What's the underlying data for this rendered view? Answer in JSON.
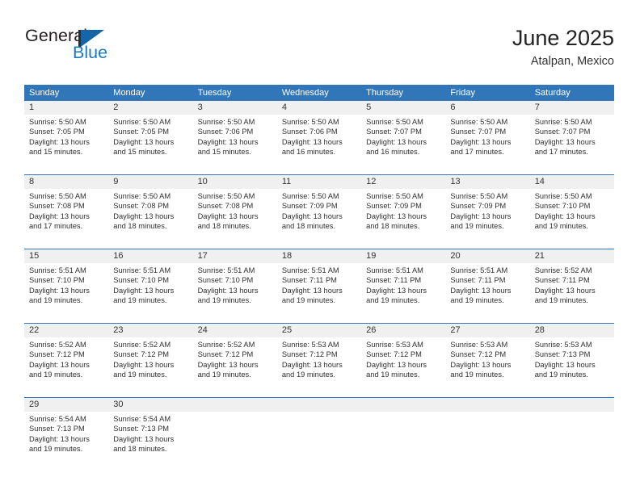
{
  "brand": {
    "name_part1": "General",
    "name_part2": "Blue",
    "logo_icon": "sailboat-logo-icon",
    "color_dark": "#231f20",
    "color_blue": "#1c7ac0"
  },
  "header": {
    "title": "June 2025",
    "location": "Atalpan, Mexico"
  },
  "theme": {
    "header_blue": "#3176b8",
    "daynum_band": "#f0f0f0",
    "text": "#303030"
  },
  "calendar": {
    "weekday_headers": [
      "Sunday",
      "Monday",
      "Tuesday",
      "Wednesday",
      "Thursday",
      "Friday",
      "Saturday"
    ],
    "weeks": [
      [
        {
          "day": "1",
          "sunrise": "Sunrise: 5:50 AM",
          "sunset": "Sunset: 7:05 PM",
          "daylight_1": "Daylight: 13 hours",
          "daylight_2": "and 15 minutes."
        },
        {
          "day": "2",
          "sunrise": "Sunrise: 5:50 AM",
          "sunset": "Sunset: 7:05 PM",
          "daylight_1": "Daylight: 13 hours",
          "daylight_2": "and 15 minutes."
        },
        {
          "day": "3",
          "sunrise": "Sunrise: 5:50 AM",
          "sunset": "Sunset: 7:06 PM",
          "daylight_1": "Daylight: 13 hours",
          "daylight_2": "and 15 minutes."
        },
        {
          "day": "4",
          "sunrise": "Sunrise: 5:50 AM",
          "sunset": "Sunset: 7:06 PM",
          "daylight_1": "Daylight: 13 hours",
          "daylight_2": "and 16 minutes."
        },
        {
          "day": "5",
          "sunrise": "Sunrise: 5:50 AM",
          "sunset": "Sunset: 7:07 PM",
          "daylight_1": "Daylight: 13 hours",
          "daylight_2": "and 16 minutes."
        },
        {
          "day": "6",
          "sunrise": "Sunrise: 5:50 AM",
          "sunset": "Sunset: 7:07 PM",
          "daylight_1": "Daylight: 13 hours",
          "daylight_2": "and 17 minutes."
        },
        {
          "day": "7",
          "sunrise": "Sunrise: 5:50 AM",
          "sunset": "Sunset: 7:07 PM",
          "daylight_1": "Daylight: 13 hours",
          "daylight_2": "and 17 minutes."
        }
      ],
      [
        {
          "day": "8",
          "sunrise": "Sunrise: 5:50 AM",
          "sunset": "Sunset: 7:08 PM",
          "daylight_1": "Daylight: 13 hours",
          "daylight_2": "and 17 minutes."
        },
        {
          "day": "9",
          "sunrise": "Sunrise: 5:50 AM",
          "sunset": "Sunset: 7:08 PM",
          "daylight_1": "Daylight: 13 hours",
          "daylight_2": "and 18 minutes."
        },
        {
          "day": "10",
          "sunrise": "Sunrise: 5:50 AM",
          "sunset": "Sunset: 7:08 PM",
          "daylight_1": "Daylight: 13 hours",
          "daylight_2": "and 18 minutes."
        },
        {
          "day": "11",
          "sunrise": "Sunrise: 5:50 AM",
          "sunset": "Sunset: 7:09 PM",
          "daylight_1": "Daylight: 13 hours",
          "daylight_2": "and 18 minutes."
        },
        {
          "day": "12",
          "sunrise": "Sunrise: 5:50 AM",
          "sunset": "Sunset: 7:09 PM",
          "daylight_1": "Daylight: 13 hours",
          "daylight_2": "and 18 minutes."
        },
        {
          "day": "13",
          "sunrise": "Sunrise: 5:50 AM",
          "sunset": "Sunset: 7:09 PM",
          "daylight_1": "Daylight: 13 hours",
          "daylight_2": "and 19 minutes."
        },
        {
          "day": "14",
          "sunrise": "Sunrise: 5:50 AM",
          "sunset": "Sunset: 7:10 PM",
          "daylight_1": "Daylight: 13 hours",
          "daylight_2": "and 19 minutes."
        }
      ],
      [
        {
          "day": "15",
          "sunrise": "Sunrise: 5:51 AM",
          "sunset": "Sunset: 7:10 PM",
          "daylight_1": "Daylight: 13 hours",
          "daylight_2": "and 19 minutes."
        },
        {
          "day": "16",
          "sunrise": "Sunrise: 5:51 AM",
          "sunset": "Sunset: 7:10 PM",
          "daylight_1": "Daylight: 13 hours",
          "daylight_2": "and 19 minutes."
        },
        {
          "day": "17",
          "sunrise": "Sunrise: 5:51 AM",
          "sunset": "Sunset: 7:10 PM",
          "daylight_1": "Daylight: 13 hours",
          "daylight_2": "and 19 minutes."
        },
        {
          "day": "18",
          "sunrise": "Sunrise: 5:51 AM",
          "sunset": "Sunset: 7:11 PM",
          "daylight_1": "Daylight: 13 hours",
          "daylight_2": "and 19 minutes."
        },
        {
          "day": "19",
          "sunrise": "Sunrise: 5:51 AM",
          "sunset": "Sunset: 7:11 PM",
          "daylight_1": "Daylight: 13 hours",
          "daylight_2": "and 19 minutes."
        },
        {
          "day": "20",
          "sunrise": "Sunrise: 5:51 AM",
          "sunset": "Sunset: 7:11 PM",
          "daylight_1": "Daylight: 13 hours",
          "daylight_2": "and 19 minutes."
        },
        {
          "day": "21",
          "sunrise": "Sunrise: 5:52 AM",
          "sunset": "Sunset: 7:11 PM",
          "daylight_1": "Daylight: 13 hours",
          "daylight_2": "and 19 minutes."
        }
      ],
      [
        {
          "day": "22",
          "sunrise": "Sunrise: 5:52 AM",
          "sunset": "Sunset: 7:12 PM",
          "daylight_1": "Daylight: 13 hours",
          "daylight_2": "and 19 minutes."
        },
        {
          "day": "23",
          "sunrise": "Sunrise: 5:52 AM",
          "sunset": "Sunset: 7:12 PM",
          "daylight_1": "Daylight: 13 hours",
          "daylight_2": "and 19 minutes."
        },
        {
          "day": "24",
          "sunrise": "Sunrise: 5:52 AM",
          "sunset": "Sunset: 7:12 PM",
          "daylight_1": "Daylight: 13 hours",
          "daylight_2": "and 19 minutes."
        },
        {
          "day": "25",
          "sunrise": "Sunrise: 5:53 AM",
          "sunset": "Sunset: 7:12 PM",
          "daylight_1": "Daylight: 13 hours",
          "daylight_2": "and 19 minutes."
        },
        {
          "day": "26",
          "sunrise": "Sunrise: 5:53 AM",
          "sunset": "Sunset: 7:12 PM",
          "daylight_1": "Daylight: 13 hours",
          "daylight_2": "and 19 minutes."
        },
        {
          "day": "27",
          "sunrise": "Sunrise: 5:53 AM",
          "sunset": "Sunset: 7:12 PM",
          "daylight_1": "Daylight: 13 hours",
          "daylight_2": "and 19 minutes."
        },
        {
          "day": "28",
          "sunrise": "Sunrise: 5:53 AM",
          "sunset": "Sunset: 7:13 PM",
          "daylight_1": "Daylight: 13 hours",
          "daylight_2": "and 19 minutes."
        }
      ],
      [
        {
          "day": "29",
          "sunrise": "Sunrise: 5:54 AM",
          "sunset": "Sunset: 7:13 PM",
          "daylight_1": "Daylight: 13 hours",
          "daylight_2": "and 19 minutes."
        },
        {
          "day": "30",
          "sunrise": "Sunrise: 5:54 AM",
          "sunset": "Sunset: 7:13 PM",
          "daylight_1": "Daylight: 13 hours",
          "daylight_2": "and 18 minutes."
        },
        null,
        null,
        null,
        null,
        null
      ]
    ]
  }
}
